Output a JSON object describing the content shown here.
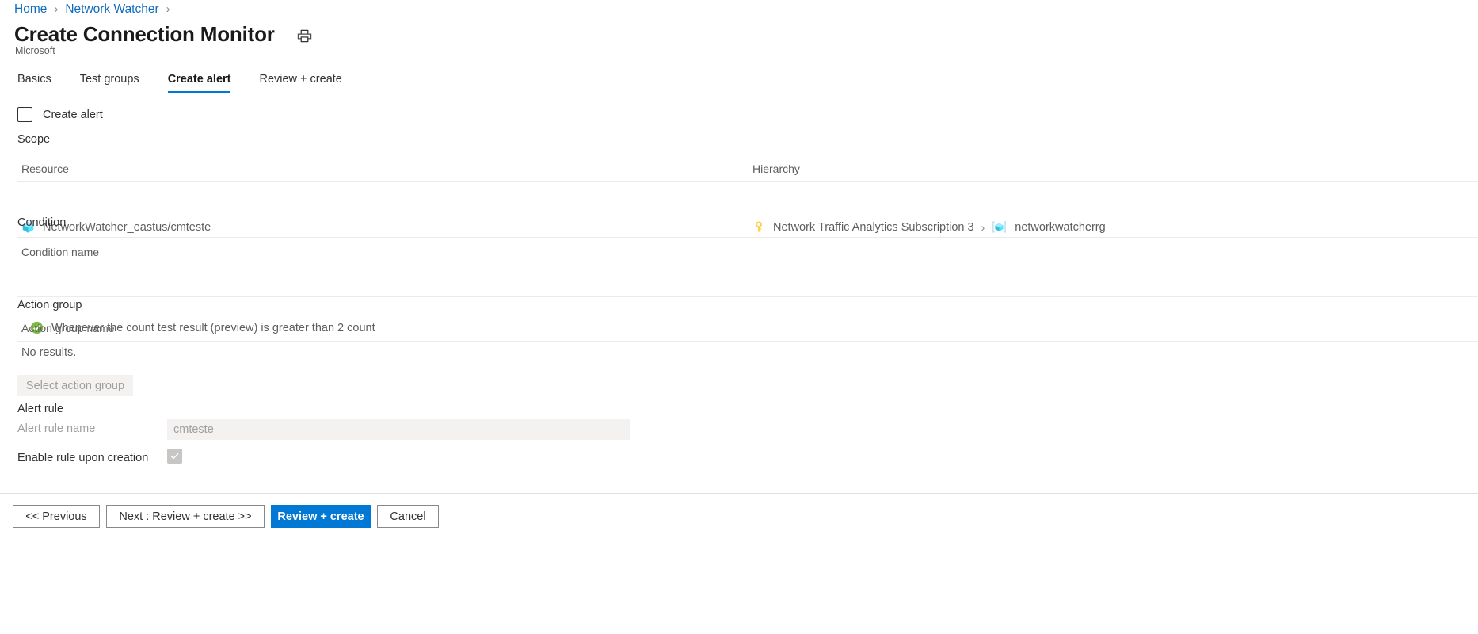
{
  "breadcrumb": {
    "items": [
      {
        "label": "Home"
      },
      {
        "label": "Network Watcher"
      }
    ],
    "separator": "›"
  },
  "header": {
    "title": "Create Connection Monitor",
    "publisher": "Microsoft",
    "print_icon": "print-icon"
  },
  "tabs": [
    {
      "label": "Basics",
      "active": false
    },
    {
      "label": "Test groups",
      "active": false
    },
    {
      "label": "Create alert",
      "active": true
    },
    {
      "label": "Review + create",
      "active": false
    }
  ],
  "create_alert": {
    "label": "Create alert",
    "checked": false
  },
  "scope": {
    "section_label": "Scope",
    "columns": {
      "resource": "Resource",
      "hierarchy": "Hierarchy"
    },
    "row": {
      "resource_icon": "azure-resource-cube-icon",
      "resource_name": "NetworkWatcher_eastus/cmteste",
      "subscription_icon": "key-icon",
      "subscription_name": "Network Traffic Analytics Subscription 3",
      "hierarchy_separator": "›",
      "resource_group_icon": "resource-group-icon",
      "resource_group_name": "networkwatcherrg"
    }
  },
  "condition": {
    "section_label": "Condition",
    "column_label": "Condition name",
    "status_icon": "green-check-circle-icon",
    "text": "Whenever the count test result (preview) is greater than 2 count"
  },
  "action_group": {
    "section_label": "Action group",
    "column_label": "Action group name",
    "empty_text": "No results.",
    "select_button": "Select action group"
  },
  "alert_rule": {
    "section_label": "Alert rule",
    "name_label": "Alert rule name",
    "name_value": "cmteste",
    "enable_label": "Enable rule upon creation",
    "enable_checked": true
  },
  "footer": {
    "previous": "<< Previous",
    "next": "Next : Review + create >>",
    "review_create": "Review + create",
    "cancel": "Cancel"
  },
  "colors": {
    "accent": "#0078d4",
    "link": "#0f6cbd",
    "success": "#7fba42",
    "key_icon": "#ffd04a",
    "cube_icon": "#50e6ff",
    "divider": "#edebe9",
    "disabled_bg": "#f3f2f1",
    "disabled_text": "#a19f9d"
  }
}
